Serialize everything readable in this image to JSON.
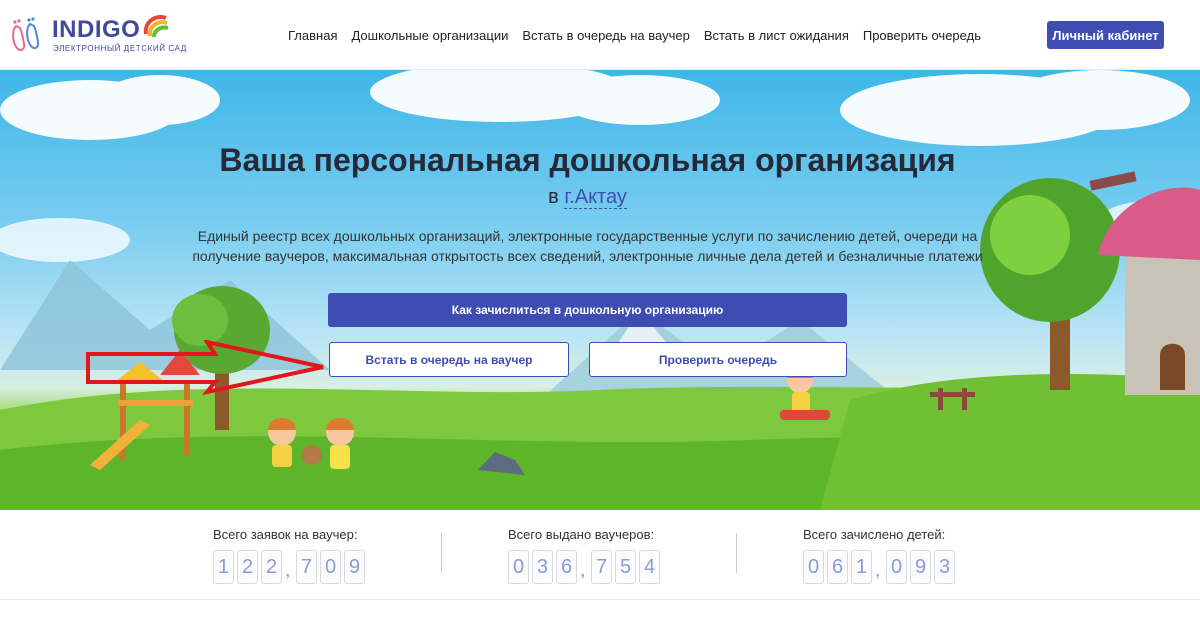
{
  "header": {
    "logo_word": "INDIGO",
    "logo_sub": "ЭЛЕКТРОННЫЙ ДЕТСКИЙ САД",
    "nav": [
      "Главная",
      "Дошкольные организации",
      "Встать в очередь на ваучер",
      "Встать в лист ожидания",
      "Проверить очередь"
    ],
    "cabinet_label": "Личный кабинет"
  },
  "hero": {
    "title": "Ваша персональная дошкольная организация",
    "city_prefix": "в",
    "city": "г.Актау",
    "description": "Единый реестр всех дошкольных организаций, электронные государственные услуги по зачислению детей, очереди на получение ваучеров, максимальная открытость всех сведений, электронные личные дела детей и безналичные платежи",
    "primary_button": "Как зачислиться в дошкольную организацию",
    "voucher_button": "Встать в очередь на ваучер",
    "check_button": "Проверить очередь"
  },
  "stats": [
    {
      "label": "Всего заявок на ваучер:",
      "digits": [
        "1",
        "2",
        "2",
        ",",
        "7",
        "0",
        "9"
      ]
    },
    {
      "label": "Всего выдано ваучеров:",
      "digits": [
        "0",
        "3",
        "6",
        ",",
        "7",
        "5",
        "4"
      ]
    },
    {
      "label": "Всего зачислено детей:",
      "digits": [
        "0",
        "6",
        "1",
        ",",
        "0",
        "9",
        "3"
      ]
    }
  ],
  "colors": {
    "accent": "#3f4cb2",
    "arrow": "#e3161c"
  }
}
